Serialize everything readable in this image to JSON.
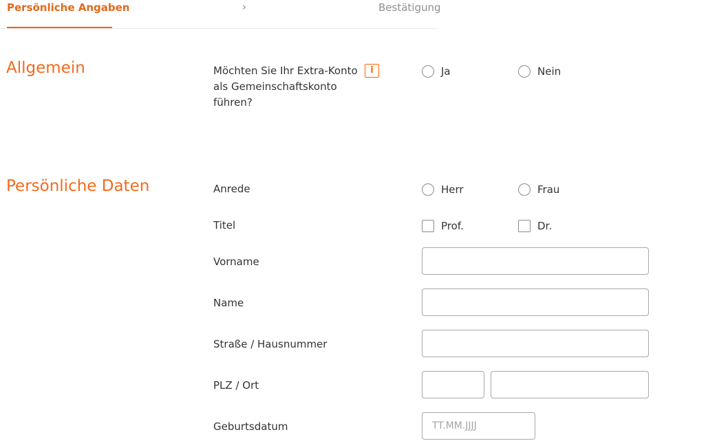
{
  "progress": {
    "active_step": "Persönliche Angaben",
    "separator": "›",
    "next_step": "Bestätigung"
  },
  "sections": {
    "allgemein": {
      "title": "Allgemein",
      "question": "Möchten Sie Ihr Extra-Konto als Gemeinschaftskonto führen?",
      "info_icon": "i",
      "options": [
        "Ja",
        "Nein"
      ]
    },
    "personal": {
      "title": "Persönliche Daten",
      "salutation_label": "Anrede",
      "salutation_options": [
        "Herr",
        "Frau"
      ],
      "title_label": "Titel",
      "title_options": [
        "Prof.",
        "Dr."
      ],
      "firstname_label": "Vorname",
      "firstname_value": "",
      "name_label": "Name",
      "name_value": "",
      "street_label": "Straße / Hausnummer",
      "street_value": "",
      "zip_city_label": "PLZ / Ort",
      "zip_value": "",
      "city_value": "",
      "birthdate_label": "Geburtsdatum",
      "birthdate_placeholder": "TT.MM.JJJJ"
    }
  },
  "colors": {
    "accent": "#ff6200",
    "heading": "#f26b1d",
    "text": "#333333",
    "muted": "#8f8f8f",
    "border": "#a8a8a8"
  }
}
